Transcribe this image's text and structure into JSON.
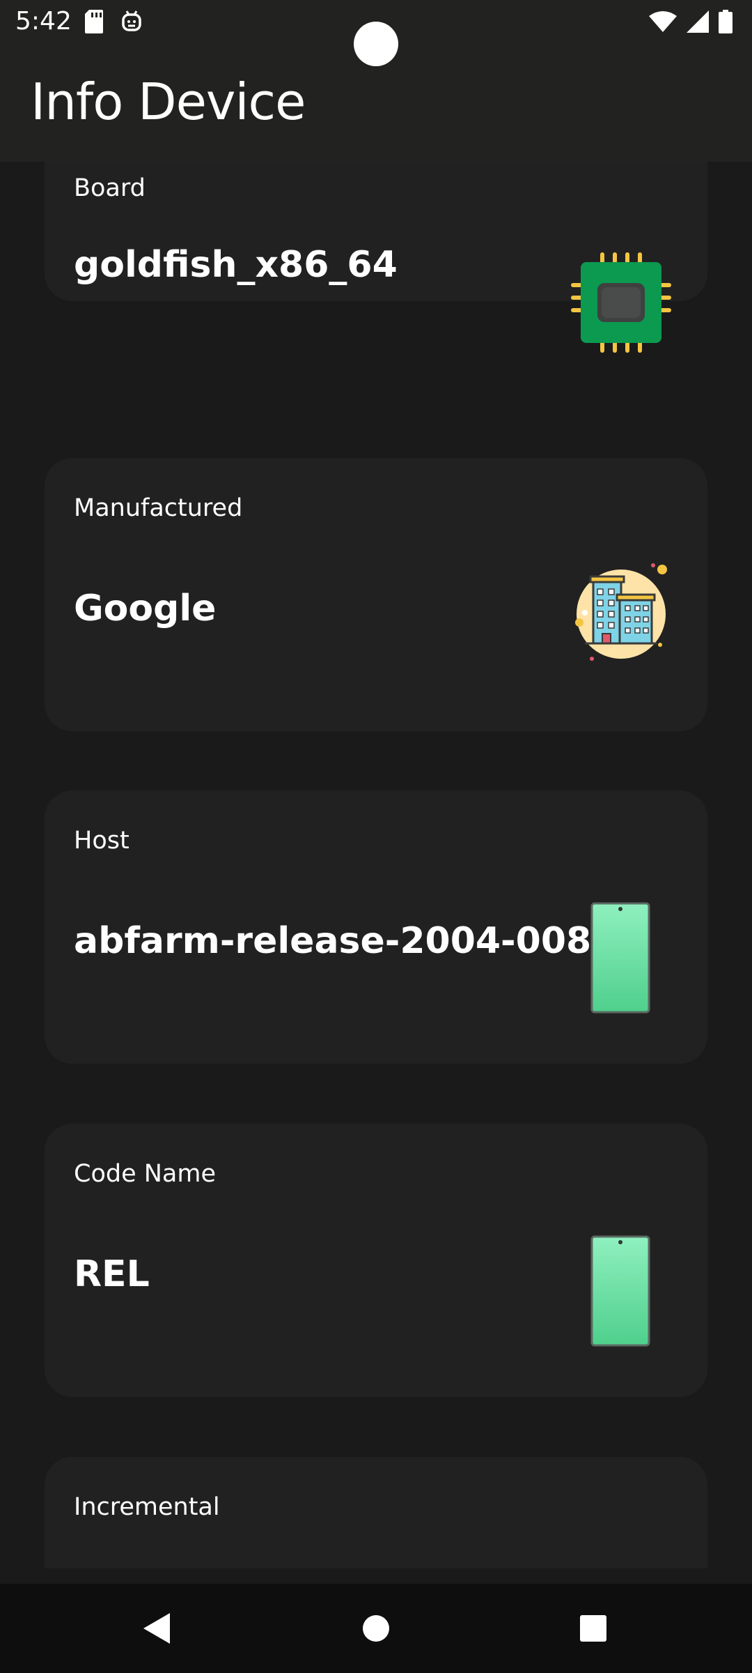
{
  "status_bar": {
    "time": "5:42",
    "left_icons": [
      "sd-card-icon",
      "app-notification-icon"
    ],
    "right_icons": [
      "wifi-icon",
      "cell-signal-icon",
      "battery-icon"
    ]
  },
  "app_bar": {
    "title": "Info Device"
  },
  "cards": [
    {
      "label": "Board",
      "value": "goldfish_x86_64",
      "icon": "chip-icon"
    },
    {
      "label": "Manufactured",
      "value": "Google",
      "icon": "building-icon"
    },
    {
      "label": "Host",
      "value": "abfarm-release-2004-0082",
      "icon": "phone-icon"
    },
    {
      "label": "Code Name",
      "value": "REL",
      "icon": "phone-icon"
    },
    {
      "label": "Incremental",
      "value": "",
      "icon": "phone-icon"
    }
  ],
  "nav_bar": {
    "buttons": [
      "back-button",
      "home-button",
      "recents-button"
    ]
  },
  "colors": {
    "background": "#1b1a1b",
    "card": "#222121",
    "app_bar": "#222221",
    "nav_bar": "#0e0e0e",
    "chip_green": "#0b9a50",
    "phone_green": "#6ee6a4"
  }
}
